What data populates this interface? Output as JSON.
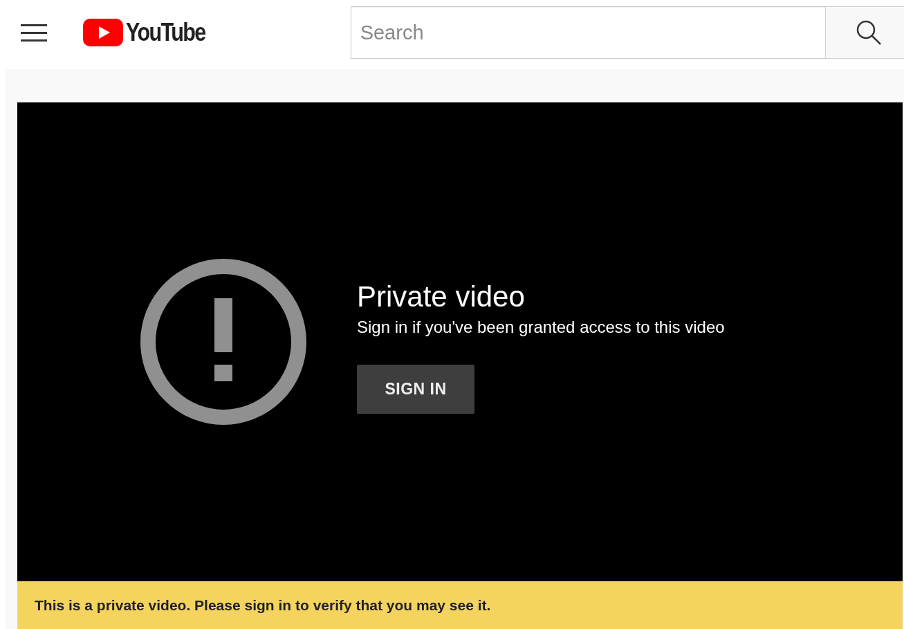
{
  "header": {
    "logo_text": "YouTube",
    "search": {
      "placeholder": "Search"
    }
  },
  "player": {
    "title": "Private video",
    "message": "Sign in if you've been granted access to this video",
    "button": "SIGN IN"
  },
  "banner": {
    "text": "This is a private video. Please sign in to verify that you may see it."
  }
}
